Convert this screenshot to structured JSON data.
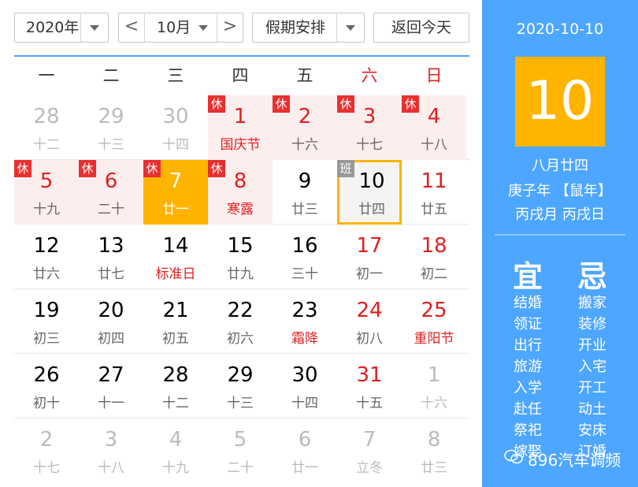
{
  "toolbar": {
    "year": "2020年",
    "prev_arrow": "<",
    "month": "10月",
    "next_arrow": ">",
    "holiday": "假期安排",
    "today_button": "返回今天"
  },
  "weekdays": [
    "一",
    "二",
    "三",
    "四",
    "五",
    "六",
    "日"
  ],
  "weeks": [
    [
      {
        "day": "28",
        "sub": "十二",
        "other": true
      },
      {
        "day": "29",
        "sub": "十三",
        "other": true
      },
      {
        "day": "30",
        "sub": "十四",
        "other": true
      },
      {
        "day": "1",
        "sub": "国庆节",
        "badge": "休",
        "holiday": true,
        "red": true,
        "subred": true
      },
      {
        "day": "2",
        "sub": "十六",
        "badge": "休",
        "holiday": true,
        "red": true
      },
      {
        "day": "3",
        "sub": "十七",
        "badge": "休",
        "holiday": true,
        "red": true
      },
      {
        "day": "4",
        "sub": "十八",
        "badge": "休",
        "holiday": true,
        "red": true
      }
    ],
    [
      {
        "day": "5",
        "sub": "十九",
        "badge": "休",
        "holiday": true,
        "red": true
      },
      {
        "day": "6",
        "sub": "二十",
        "badge": "休",
        "holiday": true,
        "red": true
      },
      {
        "day": "7",
        "sub": "廿一",
        "badge": "休",
        "selected": true
      },
      {
        "day": "8",
        "sub": "寒露",
        "badge": "休",
        "holiday": true,
        "red": true,
        "subred": true
      },
      {
        "day": "9",
        "sub": "廿三"
      },
      {
        "day": "10",
        "sub": "廿四",
        "badge": "班",
        "today": true
      },
      {
        "day": "11",
        "sub": "廿五",
        "red": true
      }
    ],
    [
      {
        "day": "12",
        "sub": "廿六"
      },
      {
        "day": "13",
        "sub": "廿七"
      },
      {
        "day": "14",
        "sub": "标准日",
        "subred": true
      },
      {
        "day": "15",
        "sub": "廿九"
      },
      {
        "day": "16",
        "sub": "三十"
      },
      {
        "day": "17",
        "sub": "初一",
        "red": true
      },
      {
        "day": "18",
        "sub": "初二",
        "red": true
      }
    ],
    [
      {
        "day": "19",
        "sub": "初三"
      },
      {
        "day": "20",
        "sub": "初四"
      },
      {
        "day": "21",
        "sub": "初五"
      },
      {
        "day": "22",
        "sub": "初六"
      },
      {
        "day": "23",
        "sub": "霜降",
        "subred": true
      },
      {
        "day": "24",
        "sub": "初八",
        "red": true
      },
      {
        "day": "25",
        "sub": "重阳节",
        "red": true,
        "subred": true
      }
    ],
    [
      {
        "day": "26",
        "sub": "初十"
      },
      {
        "day": "27",
        "sub": "十一"
      },
      {
        "day": "28",
        "sub": "十二"
      },
      {
        "day": "29",
        "sub": "十三"
      },
      {
        "day": "30",
        "sub": "十四"
      },
      {
        "day": "31",
        "sub": "十五",
        "red": true
      },
      {
        "day": "1",
        "sub": "十六",
        "other": true
      }
    ],
    [
      {
        "day": "2",
        "sub": "十七",
        "other": true
      },
      {
        "day": "3",
        "sub": "十八",
        "other": true
      },
      {
        "day": "4",
        "sub": "十九",
        "other": true
      },
      {
        "day": "5",
        "sub": "二十",
        "other": true
      },
      {
        "day": "6",
        "sub": "廿一",
        "other": true
      },
      {
        "day": "7",
        "sub": "立冬",
        "other": true
      },
      {
        "day": "8",
        "sub": "廿三",
        "other": true
      }
    ]
  ],
  "panel": {
    "date": "2020-10-10",
    "big_day": "10",
    "lunar": "八月廿四",
    "year_line": "庚子年 【鼠年】",
    "month_day_line": "丙戌月 丙戌日",
    "yi_title": "宜",
    "ji_title": "忌",
    "yi": [
      "结婚",
      "领证",
      "出行",
      "旅游",
      "入学",
      "赴任",
      "祭祀",
      "嫁娶"
    ],
    "ji": [
      "搬家",
      "装修",
      "开业",
      "入宅",
      "开工",
      "动土",
      "安床",
      "订婚"
    ]
  },
  "watermark": "896汽车调频",
  "colors": {
    "accent": "#4da6ff",
    "selected": "#ffb400",
    "holiday_bg": "#fdeeee",
    "red": "#e02020"
  }
}
